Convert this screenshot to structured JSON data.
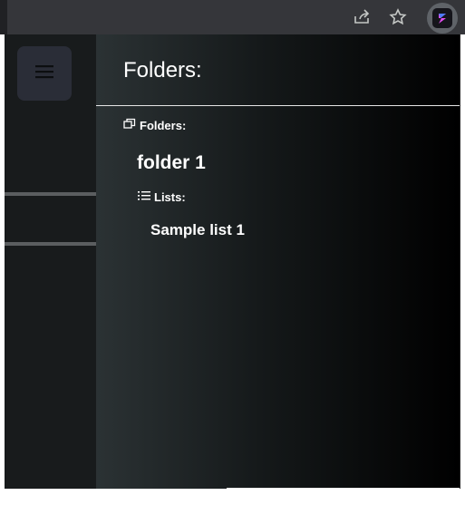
{
  "browser": {
    "share_icon": "share-icon",
    "bookmark_icon": "star-icon",
    "extension_icon": "extension-logo-icon"
  },
  "left_panel": {
    "menu_icon": "hamburger-icon"
  },
  "drawer": {
    "title": "Folders:",
    "folders_heading": "Folders:",
    "folders": [
      {
        "name": "folder 1",
        "lists_heading": "Lists:",
        "lists": [
          "Sample list 1"
        ]
      }
    ]
  },
  "colors": {
    "toolbar": "#35363a",
    "popup_bg": "#141718",
    "hamburger_bg": "#2a2d37",
    "drawer_gradient_start": "#2b3234",
    "drawer_gradient_end": "#000000",
    "text": "#ffffff"
  }
}
